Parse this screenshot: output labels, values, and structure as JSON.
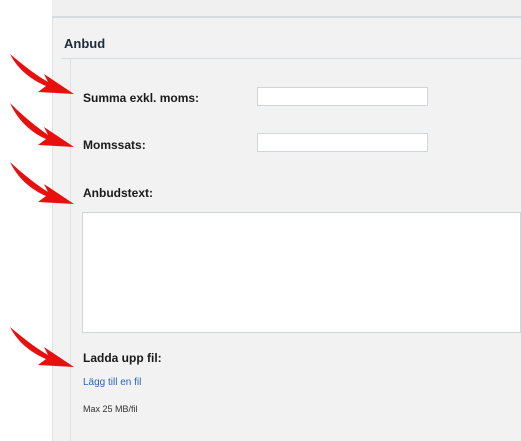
{
  "section": {
    "title": "Anbud"
  },
  "fields": {
    "amount_label": "Summa exkl. moms:",
    "amount_value": "",
    "vat_label": "Momssats:",
    "vat_value": "",
    "bid_text_label": "Anbudstext:",
    "bid_text_value": "",
    "upload_label": "Ladda upp fil:",
    "add_file_link": "Lägg till en fil",
    "max_size_hint": "Max 25 MB/fil"
  },
  "annotations": {
    "arrow_color": "#e8100f",
    "arrow_icon": "red-arrow-icon",
    "arrow_count": 4
  },
  "colors": {
    "panel_bg": "#f2f2f2",
    "link": "#2a66b5",
    "title": "#1d2a3a"
  }
}
